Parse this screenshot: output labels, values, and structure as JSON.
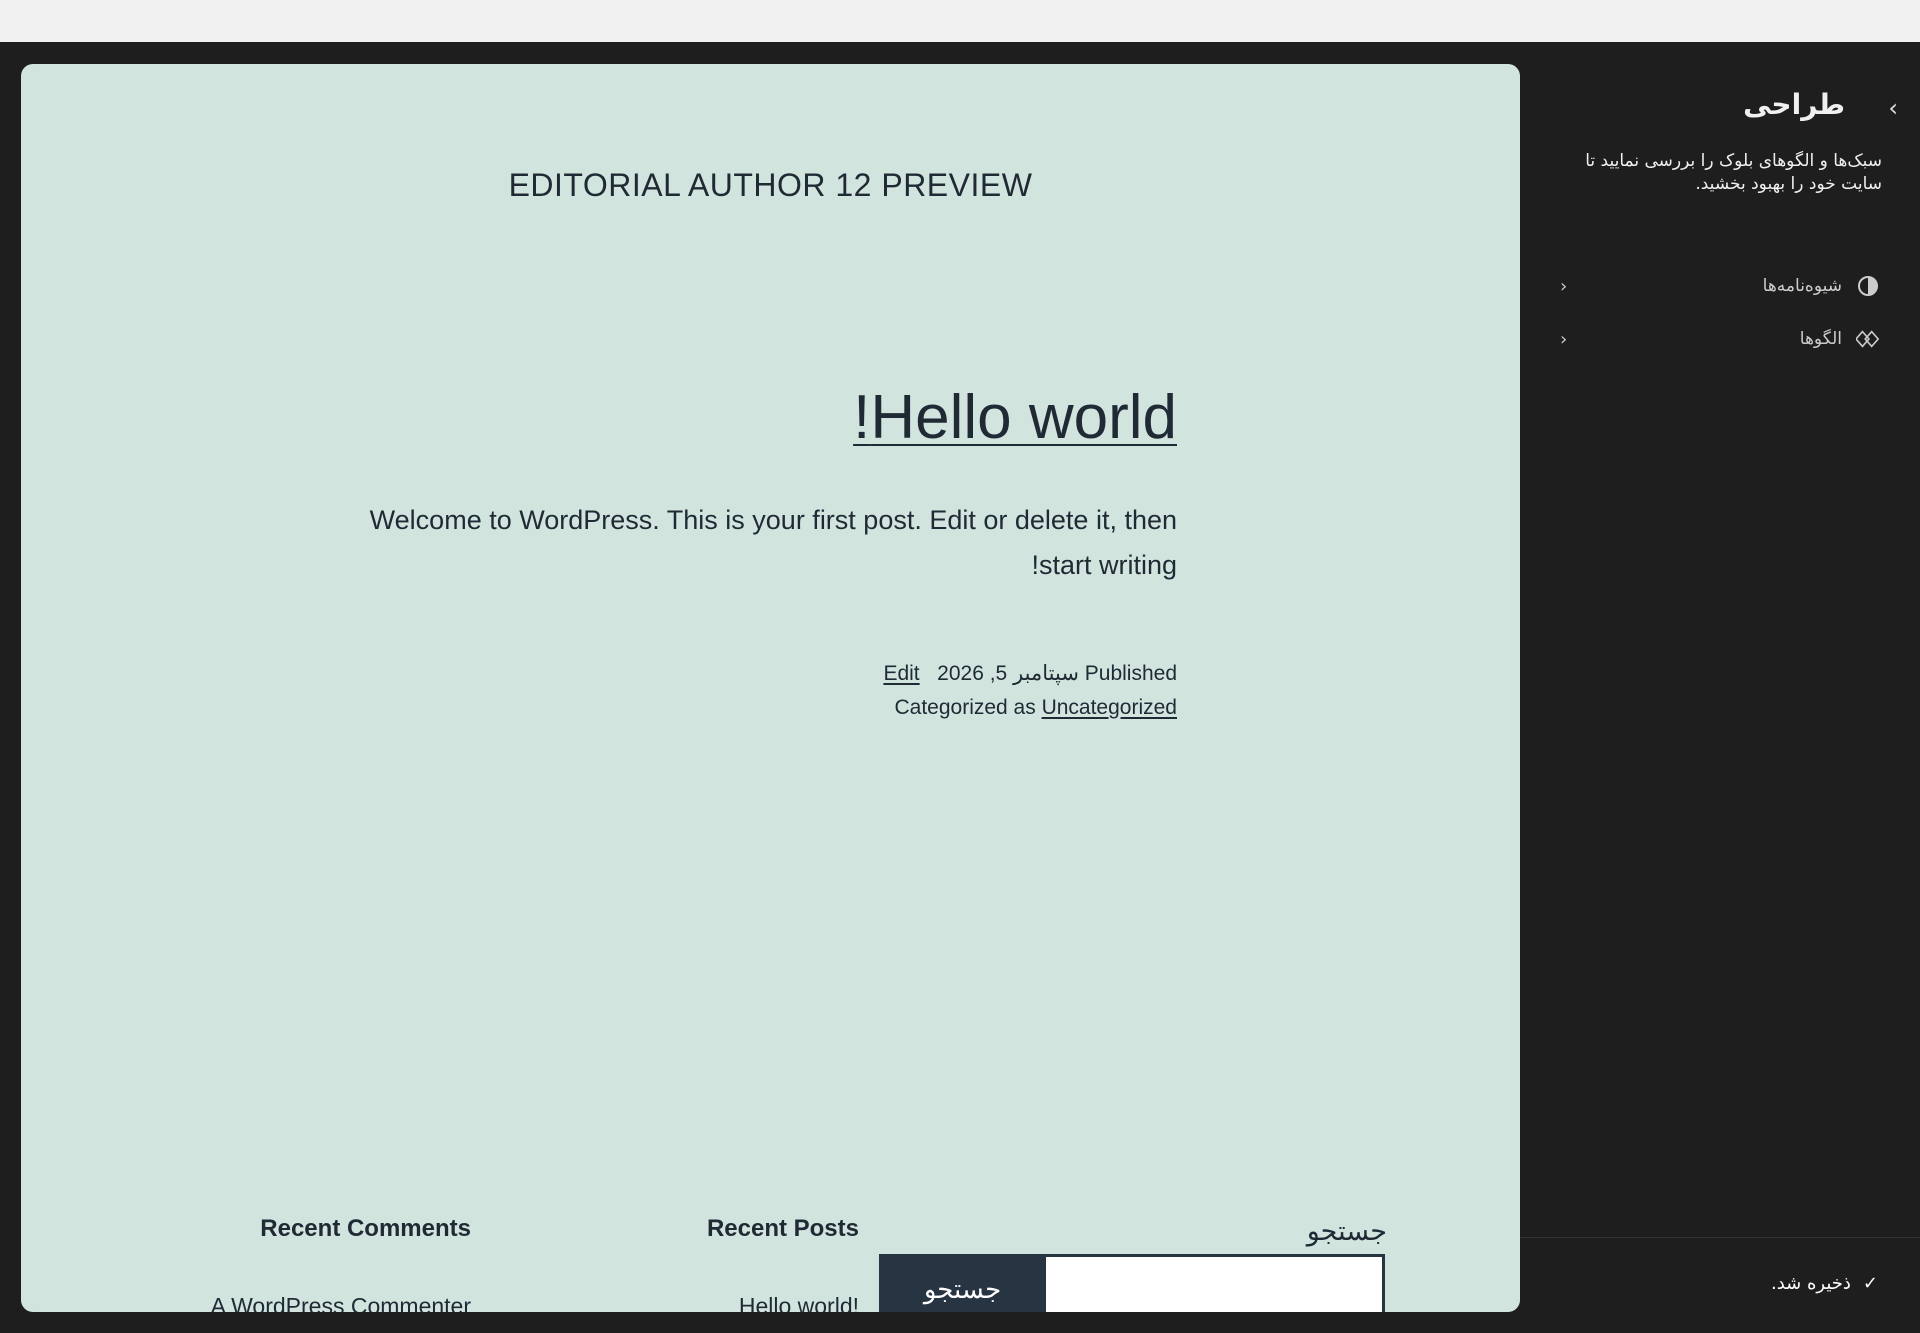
{
  "preview": {
    "site_title": "EDITORIAL AUTHOR 12 PREVIEW",
    "post": {
      "title": "Hello world!",
      "body": "Welcome to WordPress. This is your first post. Edit or delete it, then start writing!",
      "published_prefix": "Published",
      "date": "سپتامبر 5, 2026",
      "edit_link": "Edit",
      "categorized_prefix": "Categorized as",
      "category": "Uncategorized"
    },
    "footer": {
      "search_label": "جستجو",
      "search_button": "جستجو",
      "search_value": "",
      "recent_posts_title": "Recent Posts",
      "recent_posts": [
        "Hello world!"
      ],
      "recent_comments_title": "Recent Comments",
      "recent_comments": [
        "A WordPress Commenter"
      ]
    }
  },
  "sidebar": {
    "back_icon": "chevron-right-icon",
    "title": "طراحی",
    "description": "سبک‌ها و الگوهای بلوک را بررسی نمایید تا سایت خود را بهبود بخشید.",
    "items": [
      {
        "label": "شیوه‌نامه‌ها",
        "icon": "half-circle-contrast-icon"
      },
      {
        "label": "الگوها",
        "icon": "diamond-pattern-icon"
      }
    ],
    "status": "ذخیره شد."
  },
  "colors": {
    "preview_bg": "#d2e4de",
    "text": "#1f2a34",
    "sidebar_bg": "#1e1e1e",
    "button_bg": "#273441"
  }
}
